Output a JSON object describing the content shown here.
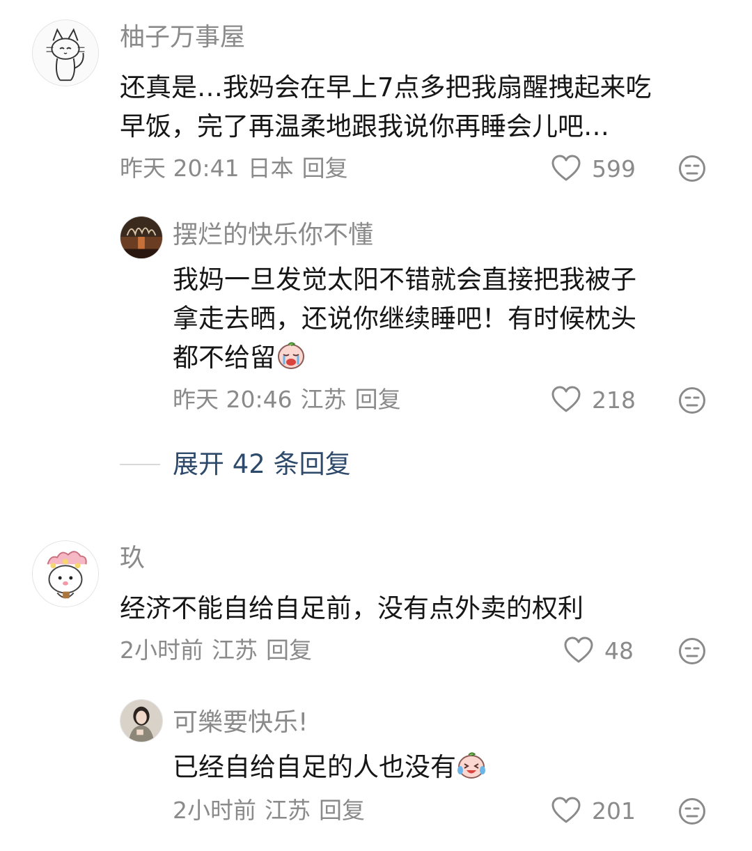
{
  "comments": [
    {
      "user": "柚子万事屋",
      "text": "还真是…我妈会在早上7点多把我扇醒拽起来吃\n早饭，完了再温柔地跟我说你再睡会儿吧…",
      "time": "昨天 20:41",
      "location": "日本",
      "reply_label": "回复",
      "likes": "599",
      "avatar_icon": "cat-sketch-avatar",
      "replies": [
        {
          "user": "摆烂的快乐你不懂",
          "text": "我妈一旦发觉太阳不错就会直接把我被子\n拿走去晒，还说你继续睡吧！有时候枕头\n都不给留",
          "emoji": "crying-emoji",
          "time": "昨天 20:46",
          "location": "江苏",
          "reply_label": "回复",
          "likes": "218",
          "avatar_icon": "dark-photo-avatar"
        }
      ],
      "expand_label": "展开 42 条回复"
    },
    {
      "user": "玖",
      "text": "经济不能自给自足前，没有点外卖的权利",
      "time": "2小时前",
      "location": "江苏",
      "reply_label": "回复",
      "likes": "48",
      "avatar_icon": "pink-flower-character-avatar",
      "replies": [
        {
          "user": "可樂要快乐!",
          "text": "已经自给自足的人也没有",
          "emoji": "laughing-crying-emoji",
          "time": "2小时前",
          "location": "江苏",
          "reply_label": "回复",
          "likes": "201",
          "avatar_icon": "girl-photo-avatar"
        }
      ]
    }
  ],
  "colors": {
    "text": "#161616",
    "meta": "#8a8a8a",
    "link": "#2e4a6b"
  }
}
